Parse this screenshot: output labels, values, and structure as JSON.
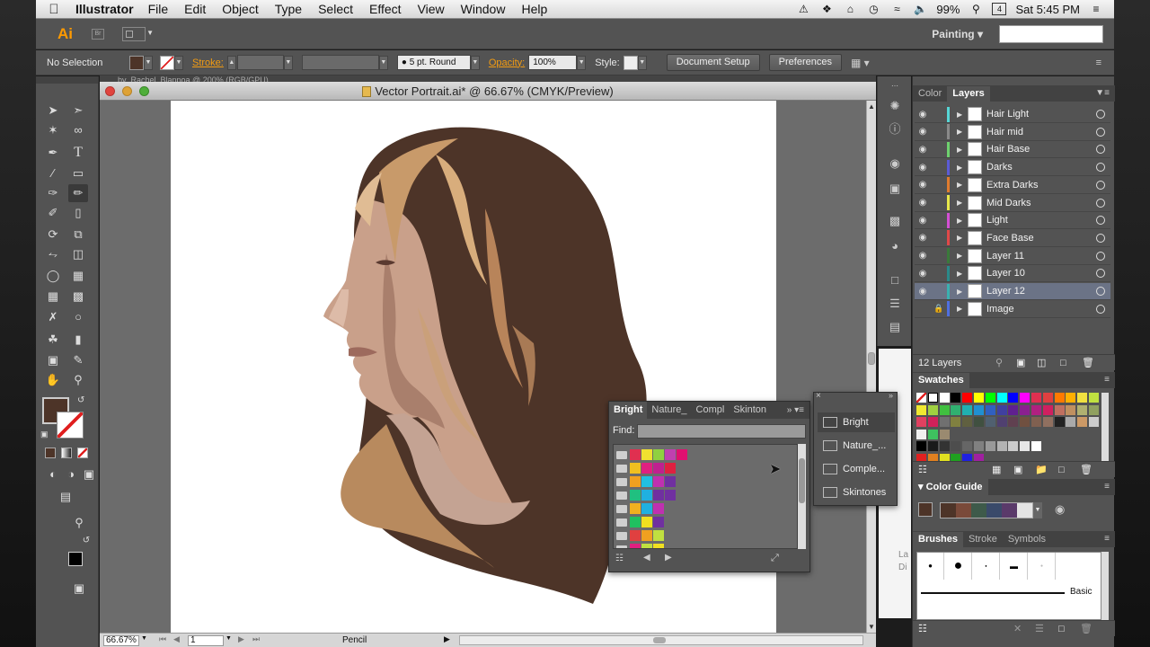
{
  "menubar": {
    "app": "Illustrator",
    "menus": [
      "File",
      "Edit",
      "Object",
      "Type",
      "Select",
      "Effect",
      "View",
      "Window",
      "Help"
    ],
    "battery": "99%",
    "calendar_day": "4",
    "clock": "Sat 5:45 PM"
  },
  "appbar": {
    "logo": "Ai",
    "bridge": "Br",
    "workspace": "Painting"
  },
  "controlbar": {
    "selection": "No Selection",
    "stroke_label": "Stroke:",
    "brush": "5 pt. Round",
    "opacity_label": "Opacity:",
    "opacity_value": "100%",
    "style_label": "Style:",
    "document_setup": "Document Setup",
    "preferences": "Preferences"
  },
  "document": {
    "tab_text": "by_Rachel_Blanpoa @ 200% (RGB/GPU)",
    "title": "Vector Portrait.ai* @ 66.67% (CMYK/Preview)"
  },
  "status": {
    "zoom": "66.67%",
    "page": "1",
    "tool": "Pencil"
  },
  "layers_panel": {
    "tabs": [
      "Color",
      "Layers"
    ],
    "active_tab": "Layers",
    "layers": [
      {
        "name": "Hair Light",
        "color": "#56d6d6",
        "visible": true
      },
      {
        "name": "Hair mid",
        "color": "#8a8a8a",
        "visible": true
      },
      {
        "name": "Hair Base",
        "color": "#6ed16e",
        "visible": true
      },
      {
        "name": "Darks",
        "color": "#5b5bd6",
        "visible": true
      },
      {
        "name": "Extra Darks",
        "color": "#e07b2e",
        "visible": true
      },
      {
        "name": "Mid Darks",
        "color": "#e8e84a",
        "visible": true
      },
      {
        "name": "Light",
        "color": "#d44fd4",
        "visible": true
      },
      {
        "name": "Face Base",
        "color": "#e04848",
        "visible": true
      },
      {
        "name": "Layer 11",
        "color": "#3a7a3a",
        "visible": true
      },
      {
        "name": "Layer 10",
        "color": "#2a8a8a",
        "visible": true
      },
      {
        "name": "Layer 12",
        "color": "#3ab0b0",
        "visible": true,
        "selected": true
      },
      {
        "name": "Image",
        "color": "#4f6fe0",
        "visible": false,
        "locked": true
      }
    ],
    "count_label": "12 Layers"
  },
  "swatches_panel": {
    "title": "Swatches"
  },
  "color_guide_panel": {
    "title": "Color Guide"
  },
  "brushes_panel": {
    "tabs": [
      "Brushes",
      "Stroke",
      "Symbols"
    ],
    "basic_label": "Basic"
  },
  "library_panel": {
    "tabs": [
      "Bright",
      "Nature_",
      "Compl",
      "Skinton"
    ],
    "find_label": "Find:"
  },
  "flyout": {
    "items": [
      "Bright",
      "Nature_...",
      "Comple...",
      "Skintones"
    ]
  },
  "underlying_text": {
    "line1": "La",
    "line2": "Di"
  },
  "colors": {
    "ui_panel": "#535353",
    "hair_dark": "#4d3428",
    "accent_orange": "#f39c12"
  }
}
